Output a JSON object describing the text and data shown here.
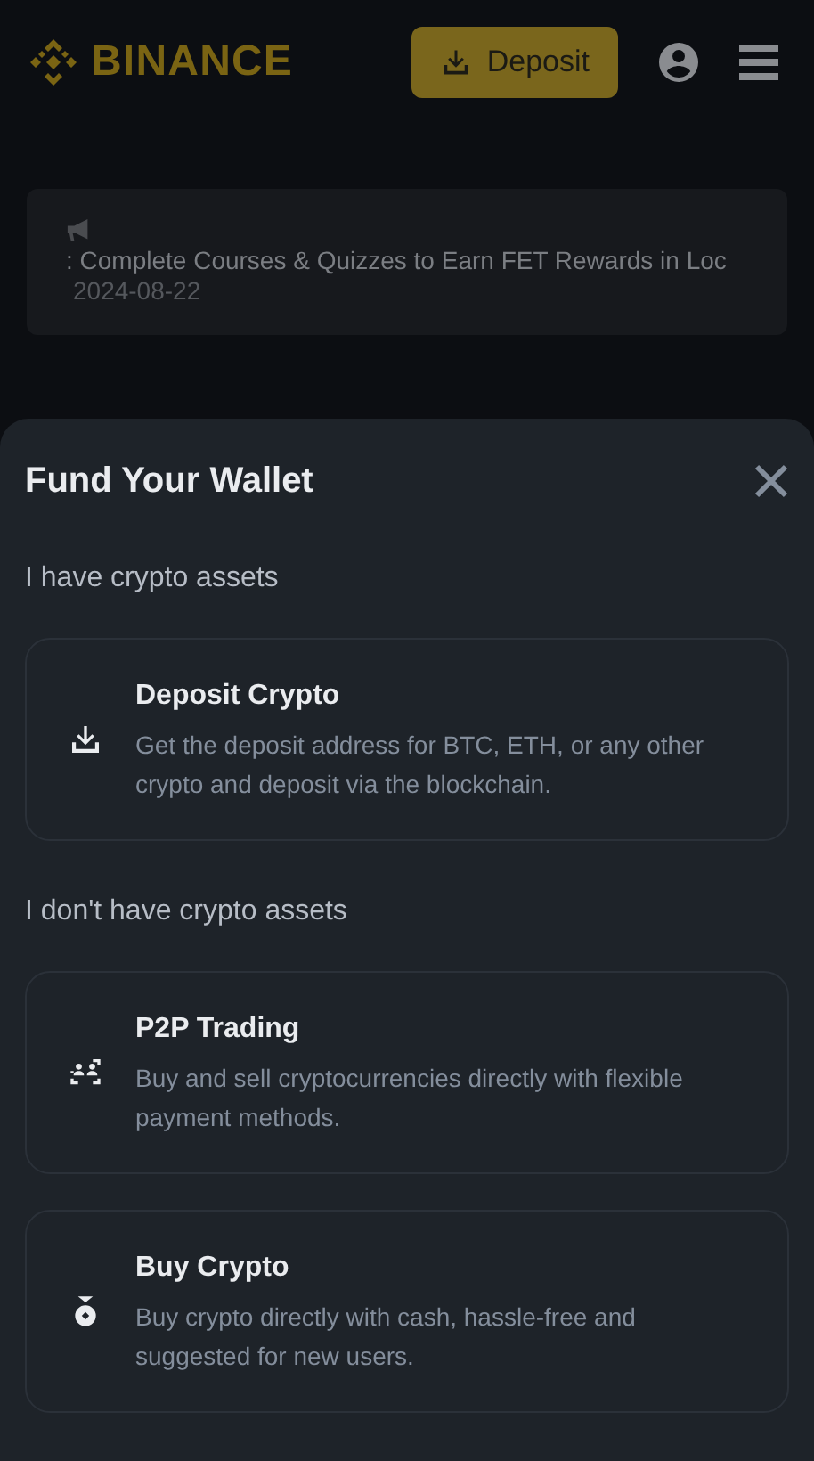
{
  "header": {
    "logo": "BINANCE",
    "deposit_button": "Deposit"
  },
  "announcement": {
    "text": ": Complete Courses & Quizzes to Earn FET Rewards in Loc",
    "date": "2024-08-22"
  },
  "sheet": {
    "title": "Fund Your Wallet",
    "sections": [
      {
        "heading": "I have crypto assets",
        "options": [
          {
            "kind": "deposit",
            "title": "Deposit Crypto",
            "description": "Get the deposit address for BTC, ETH, or any other crypto and deposit via the blockchain."
          }
        ]
      },
      {
        "heading": "I don't have crypto assets",
        "options": [
          {
            "kind": "p2p",
            "title": "P2P Trading",
            "description": "Buy and sell cryptocurrencies directly with flexible payment methods."
          },
          {
            "kind": "buy",
            "title": "Buy Crypto",
            "description": "Buy crypto directly with cash, hassle-free and suggested for new users."
          }
        ]
      }
    ]
  }
}
